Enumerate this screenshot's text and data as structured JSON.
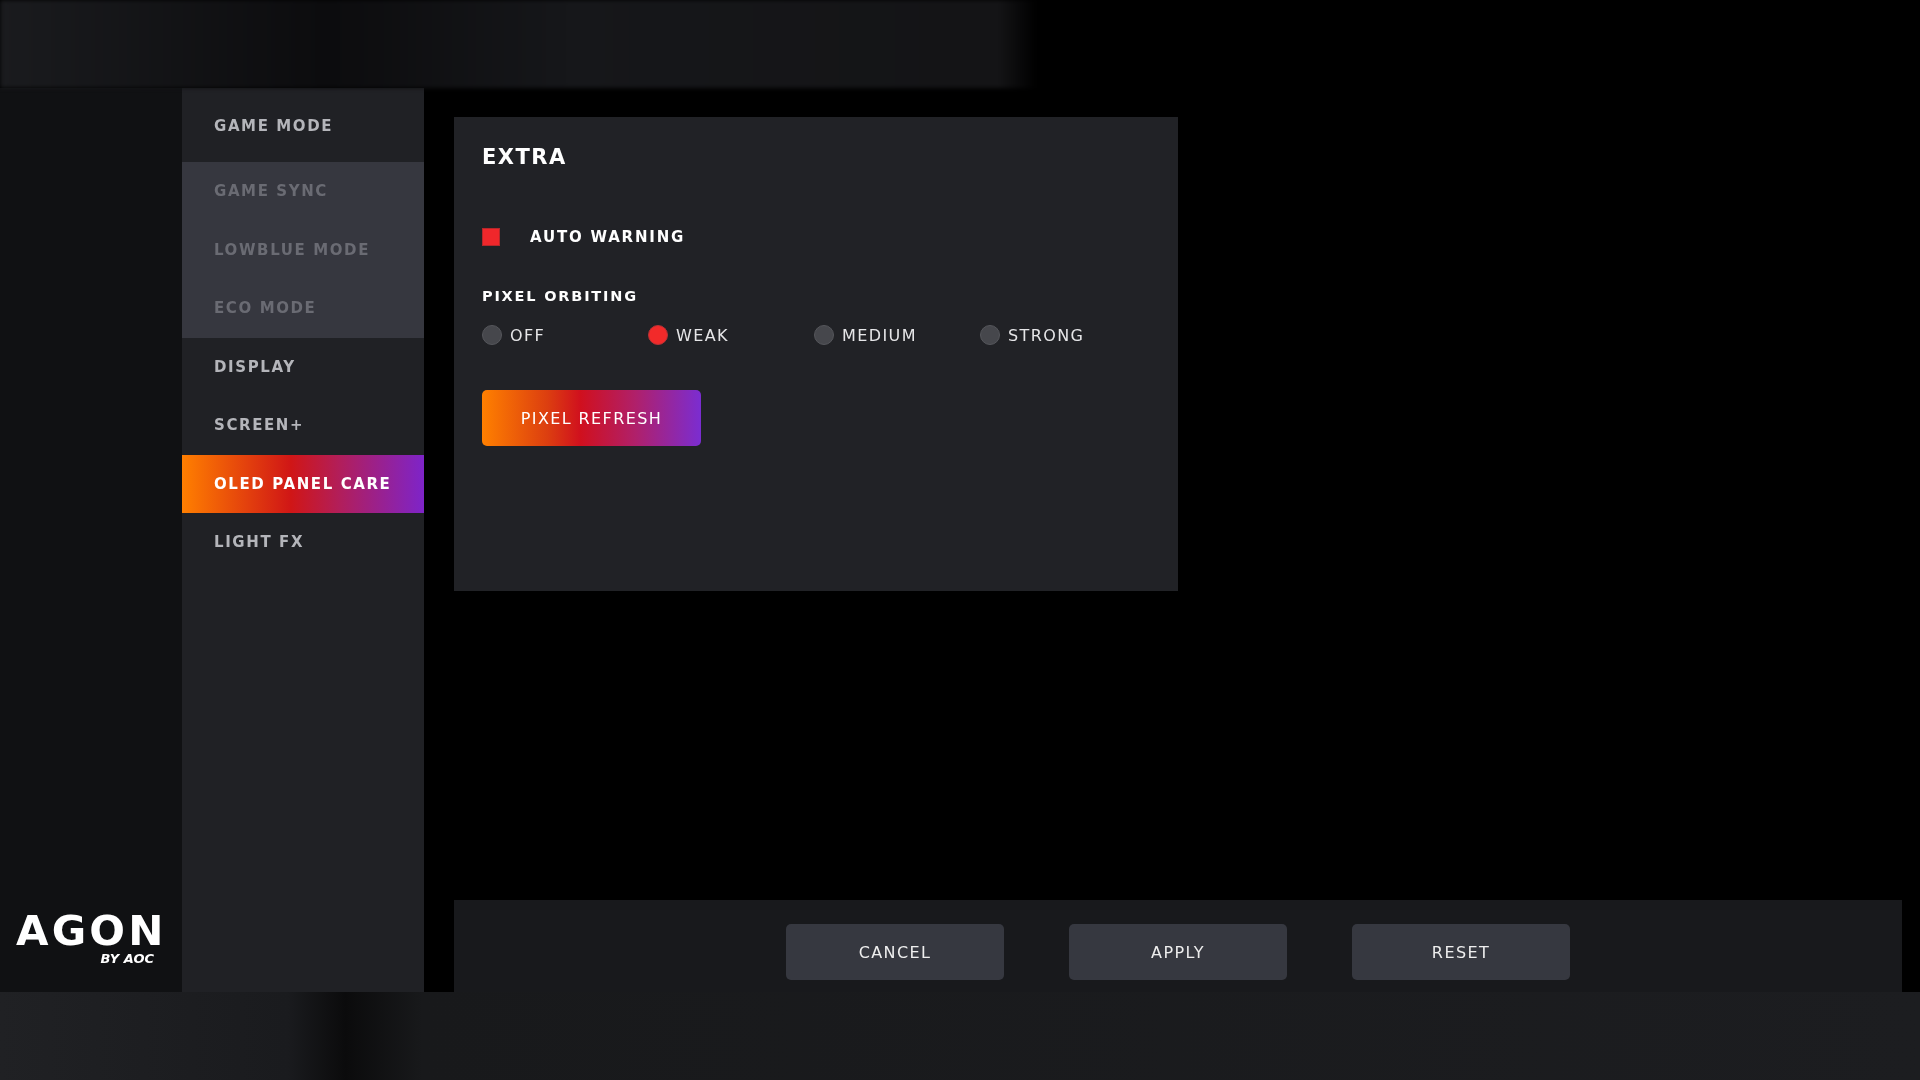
{
  "logo": {
    "brand": "AGON",
    "byline": "BY AOC"
  },
  "sidebar": {
    "items": [
      {
        "label": "GAME MODE",
        "selected": false,
        "children": [
          {
            "label": "GAME SYNC",
            "selected": false,
            "disabled": true
          },
          {
            "label": "LOWBLUE MODE",
            "selected": false,
            "disabled": true
          },
          {
            "label": "ECO MODE",
            "selected": false,
            "disabled": true
          }
        ]
      },
      {
        "label": "DISPLAY",
        "selected": false
      },
      {
        "label": "SCREEN+",
        "selected": false
      },
      {
        "label": "OLED PANEL CARE",
        "selected": true
      },
      {
        "label": "LIGHT FX",
        "selected": false
      }
    ]
  },
  "panel": {
    "title": "EXTRA",
    "auto_warning": {
      "label": "AUTO WARNING",
      "checked": true
    },
    "pixel_orbiting": {
      "label": "PIXEL ORBITING",
      "options": [
        {
          "label": "OFF",
          "selected": false
        },
        {
          "label": "WEAK",
          "selected": true
        },
        {
          "label": "MEDIUM",
          "selected": false
        },
        {
          "label": "STRONG",
          "selected": false
        }
      ]
    },
    "button": "PIXEL REFRESH"
  },
  "footer": {
    "buttons": [
      "CANCEL",
      "APPLY",
      "RESET"
    ]
  }
}
